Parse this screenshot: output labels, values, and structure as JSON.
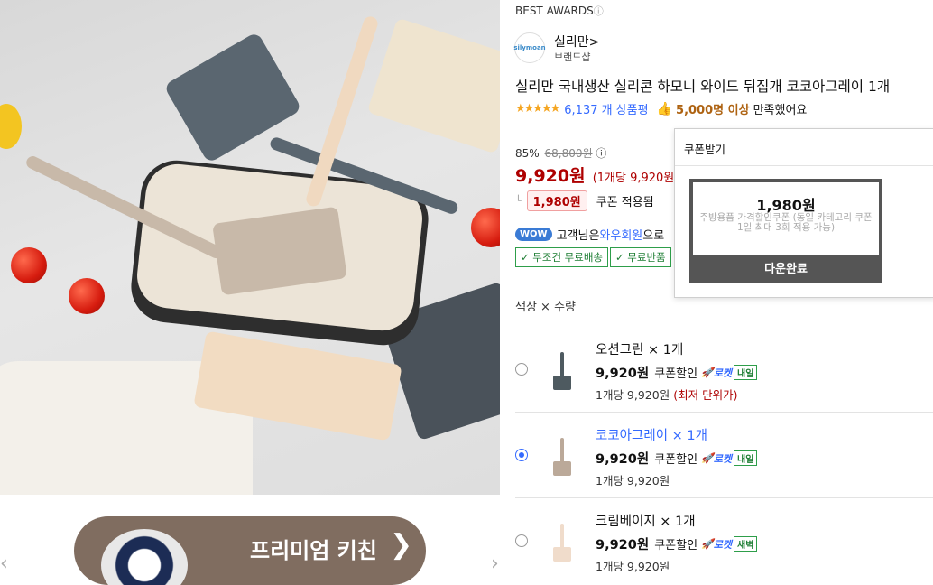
{
  "award": {
    "label": "BEST AWARDS",
    "info_icon": "ⓘ"
  },
  "brand": {
    "logo_text": "silymoan",
    "name": "실리만",
    "chevron": ">",
    "sub": "브랜드샵"
  },
  "product": {
    "title": "실리만 국내생산 실리콘 하모니 와이드 뒤집개 코코아그레이 1개",
    "stars": "★★★★★",
    "review_count": "6,137 개 상품평",
    "thumb_icon": "👍",
    "satisfaction": "5,000명 이상",
    "satisfaction_rest": "만족했어요"
  },
  "pricing": {
    "discount_rate": "85%",
    "original_price": "68,800원",
    "info_icon": "ⓘ",
    "sale_price": "9,920원",
    "unit_price": "(1개당 9,920원)",
    "coupon_corner": "└",
    "coupon_amount": "1,980원",
    "coupon_label": "쿠폰 적용됨"
  },
  "wow": {
    "badge": "WOW",
    "text_prefix": "고객님은",
    "link": "와우회원",
    "text_suffix": "으로"
  },
  "shipping": {
    "badge1": "✓ 무조건 무료배송",
    "badge2": "✓ 무료반품"
  },
  "options": {
    "title": "색상 × 수량",
    "items": [
      {
        "name": "오션그린 × 1개",
        "price": "9,920원",
        "coupon": "쿠폰할인",
        "rocket": "로켓",
        "tag": "내일",
        "unit": "1개당 9,920원",
        "lowest": "(최저 단위가)",
        "color": "#4e5a60"
      },
      {
        "name": "코코아그레이 × 1개",
        "price": "9,920원",
        "coupon": "쿠폰할인",
        "rocket": "로켓",
        "tag": "내일",
        "unit": "1개당 9,920원",
        "lowest": "",
        "color": "#bba999"
      },
      {
        "name": "크림베이지 × 1개",
        "price": "9,920원",
        "coupon": "쿠폰할인",
        "rocket": "로켓",
        "tag": "새벽",
        "unit": "1개당 9,920원",
        "lowest": "",
        "color": "#f0dccb"
      }
    ]
  },
  "coupon_popup": {
    "title": "쿠폰받기",
    "amount": "1,980원",
    "desc": "주방용품 가격할인쿠폰 (동일 카테고리 쿠폰 1일 최대 3회 적용 가능)",
    "done_label": "다운완료"
  },
  "banner": {
    "text": "프리미엄 키친",
    "arrow": "❯"
  },
  "nav": {
    "prev": "‹",
    "next": "›"
  }
}
